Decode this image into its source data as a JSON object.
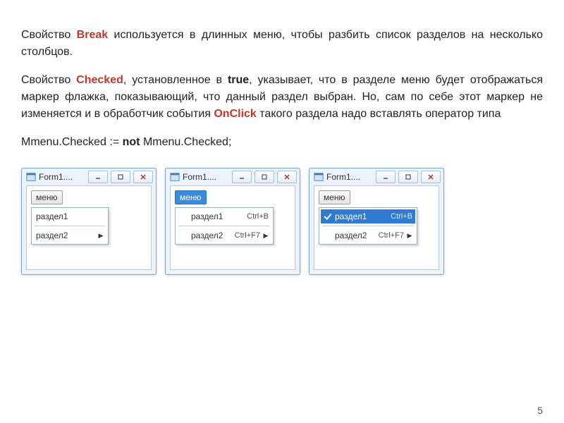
{
  "paragraphs": {
    "p1_a": "Свойство ",
    "p1_break": "Break",
    "p1_b": " используется в длинных меню, чтобы разбить список разделов на несколько столбцов.",
    "p2_a": "Свойство ",
    "p2_checked": "Checked",
    "p2_b": ", установленное в ",
    "p2_true": "true",
    "p2_c": ", указывает, что в разделе меню будет отображаться маркер флажка, показывающий, что данный раздел выбран. Но, сам по себе этот маркер не изменяется и в обработчик события ",
    "p2_onclick": "OnClick",
    "p2_d": " такого раздела надо вставлять оператор типа",
    "code_a": "Mmenu.Checked := ",
    "code_not": "not",
    "code_b": " Mmenu.Checked;"
  },
  "windows": {
    "title": "Form1....",
    "menu_button": "меню",
    "items": {
      "r1_label": "раздел1",
      "r1_shortcut": "Ctrl+B",
      "r2_label": "раздел2",
      "r2_shortcut": "Ctrl+F7"
    }
  },
  "page_number": "5"
}
